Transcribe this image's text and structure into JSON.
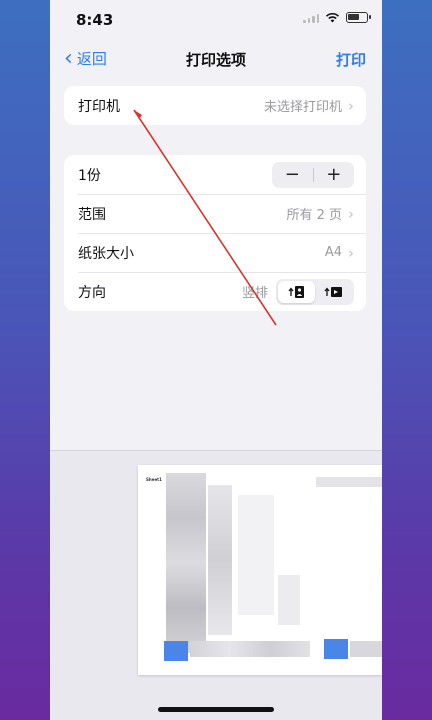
{
  "status": {
    "time": "8:43"
  },
  "nav": {
    "back_label": "返回",
    "title": "打印选项",
    "print_label": "打印"
  },
  "printer": {
    "label": "打印机",
    "value": "未选择打印机"
  },
  "copies": {
    "label": "1份",
    "minus": "−",
    "plus": "+"
  },
  "range": {
    "label": "范围",
    "value": "所有 2 页"
  },
  "paper": {
    "label": "纸张大小",
    "value": "A4"
  },
  "orientation": {
    "label": "方向",
    "value": "竖排"
  },
  "preview": {
    "page_label": "Sheet1"
  },
  "colors": {
    "accent": "#2f7cf6",
    "annotation": "#d9342b"
  }
}
